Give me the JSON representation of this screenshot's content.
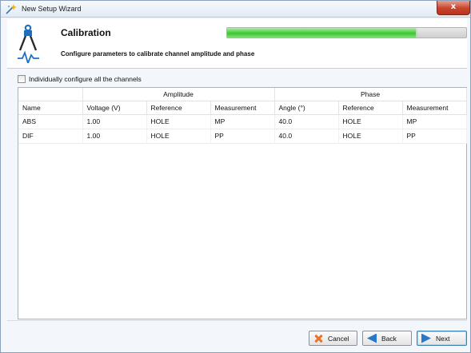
{
  "window": {
    "title": "New Setup Wizard",
    "close_label": "x"
  },
  "header": {
    "title": "Calibration",
    "description": "Configure parameters to calibrate channel amplitude and phase",
    "progress_fraction": 0.79
  },
  "options": {
    "individual_config_label": "Individually configure all the channels",
    "individual_config_checked": false
  },
  "table": {
    "groups": {
      "amplitude": "Amplitude",
      "phase": "Phase"
    },
    "columns": [
      "Name",
      "Voltage (V)",
      "Reference",
      "Measurement",
      "Angle (°)",
      "Reference",
      "Measurement"
    ],
    "rows": [
      [
        "ABS",
        "1.00",
        "HOLE",
        "MP",
        "40.0",
        "HOLE",
        "MP"
      ],
      [
        "DIF",
        "1.00",
        "HOLE",
        "PP",
        "40.0",
        "HOLE",
        "PP"
      ]
    ]
  },
  "buttons": {
    "cancel": "Cancel",
    "back": "Back",
    "next": "Next"
  },
  "colors": {
    "progress_green": "#3ec233",
    "title_bar": "#e2eaf4",
    "close_red": "#c8432b",
    "nav_blue": "#2b78c9"
  }
}
